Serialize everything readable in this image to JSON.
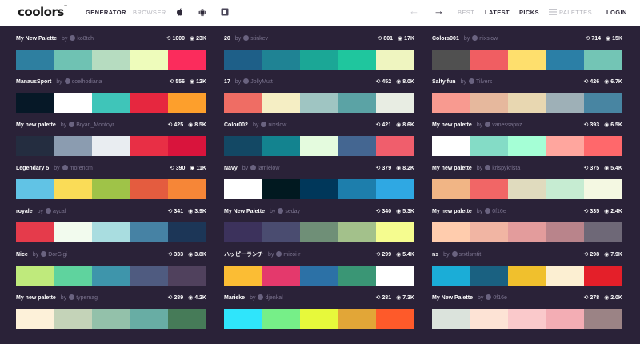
{
  "header": {
    "logo": "coolors",
    "logo_tm": "™",
    "nav": {
      "generator": "GENERATOR",
      "browser": "BROWSER",
      "best": "BEST",
      "latest": "LATEST",
      "picks": "PICKS",
      "palettes": "PALETTES",
      "login": "LOGIN"
    },
    "icons": [
      "apple-icon",
      "android-icon",
      "addon-icon",
      "back-arrow-icon",
      "forward-arrow-icon",
      "menu-icon"
    ]
  },
  "by_label": "by",
  "palettes": [
    {
      "name": "My New Palette",
      "user": "ko8tch",
      "saves": "1000",
      "views": "23K",
      "colors": [
        "#2e7fa0",
        "#6fc2b3",
        "#b6dcc0",
        "#eefcbb",
        "#fb2c5c"
      ]
    },
    {
      "name": "20",
      "user": "stinkev",
      "saves": "801",
      "views": "17K",
      "colors": [
        "#1e5f88",
        "#1f8394",
        "#1ba796",
        "#1fc69e",
        "#eff5c0"
      ]
    },
    {
      "name": "Colors001",
      "user": "nixslow",
      "saves": "714",
      "views": "15K",
      "colors": [
        "#505050",
        "#f05e62",
        "#fedf6d",
        "#2b7fa6",
        "#73c5b5"
      ]
    },
    {
      "name": "ManausSport",
      "user": "coelhodiana",
      "saves": "556",
      "views": "12K",
      "colors": [
        "#061827",
        "#ffffff",
        "#3fc5b9",
        "#e6273f",
        "#fd9f2c"
      ]
    },
    {
      "name": "17",
      "user": "JollyMutt",
      "saves": "452",
      "views": "8.0K",
      "colors": [
        "#ef6d64",
        "#f5eec4",
        "#9fc5c2",
        "#5ba3a5",
        "#e8ede3"
      ]
    },
    {
      "name": "Salty fun",
      "user": "Tilvers",
      "saves": "426",
      "views": "6.7K",
      "colors": [
        "#f89a90",
        "#e6b89d",
        "#e8d7b1",
        "#9eb0b7",
        "#4885a2"
      ]
    },
    {
      "name": "My new palette",
      "user": "Bryan_Montoyr",
      "saves": "425",
      "views": "8.5K",
      "colors": [
        "#242d40",
        "#8b9cb0",
        "#e9edf1",
        "#e82f45",
        "#d9143c"
      ]
    },
    {
      "name": "Color002",
      "user": "nixslow",
      "saves": "421",
      "views": "8.6K",
      "colors": [
        "#134864",
        "#13838f",
        "#e4fbde",
        "#446691",
        "#f05e6c"
      ]
    },
    {
      "name": "My new palette",
      "user": "vanessapnz",
      "saves": "393",
      "views": "6.5K",
      "colors": [
        "#ffffff",
        "#84dcc6",
        "#a5ffd6",
        "#ffa69e",
        "#ff686b"
      ]
    },
    {
      "name": "Legendary 5",
      "user": "morencm",
      "saves": "390",
      "views": "11K",
      "colors": [
        "#61c3e5",
        "#fadc57",
        "#9fc348",
        "#e45c3f",
        "#f68637"
      ]
    },
    {
      "name": "Navy",
      "user": "jamielow",
      "saves": "379",
      "views": "8.2K",
      "colors": [
        "#ffffff",
        "#011920",
        "#00375a",
        "#1d7eac",
        "#2fa8e3"
      ]
    },
    {
      "name": "My new palette",
      "user": "krispykrista",
      "saves": "375",
      "views": "5.4K",
      "colors": [
        "#f1b585",
        "#f16666",
        "#e0dbbe",
        "#c6ecd2",
        "#f4f8e2"
      ]
    },
    {
      "name": "royale",
      "user": "aycal",
      "saves": "341",
      "views": "3.9K",
      "colors": [
        "#e53b4b",
        "#f2fbee",
        "#a9dde0",
        "#4682a4",
        "#1c3657"
      ]
    },
    {
      "name": "My New Palette",
      "user": "seday",
      "saves": "340",
      "views": "5.3K",
      "colors": [
        "#3c325c",
        "#4a4c70",
        "#6f8f77",
        "#a3c18b",
        "#f5fc8f"
      ]
    },
    {
      "name": "My new palette",
      "user": "0f16e",
      "saves": "335",
      "views": "2.4K",
      "colors": [
        "#ffccad",
        "#f1b5a3",
        "#e39c9c",
        "#b9848b",
        "#6e6877"
      ]
    },
    {
      "name": "Nice",
      "user": "DorGigi",
      "saves": "333",
      "views": "3.8K",
      "colors": [
        "#bfea7c",
        "#5fd39e",
        "#3e95ab",
        "#4f5b80",
        "#50415d"
      ]
    },
    {
      "name": "ハッピーランチ",
      "user": "mizoi-r",
      "saves": "299",
      "views": "5.4K",
      "colors": [
        "#fbbd34",
        "#e4396c",
        "#2c71a6",
        "#3a9675",
        "#ffffff"
      ]
    },
    {
      "name": "ns",
      "user": "srxtlsmtit",
      "saves": "298",
      "views": "7.9K",
      "colors": [
        "#1badd7",
        "#1a6181",
        "#f0c02d",
        "#fcefd2",
        "#e41f29"
      ]
    },
    {
      "name": "My new palette",
      "user": "typemag",
      "saves": "289",
      "views": "4.2K",
      "colors": [
        "#fdf1d9",
        "#c4d3b8",
        "#93c1aa",
        "#68ada4",
        "#467b58"
      ]
    },
    {
      "name": "Marieke",
      "user": "djenkal",
      "saves": "281",
      "views": "7.3K",
      "colors": [
        "#2fe5fb",
        "#76ef88",
        "#e7f93b",
        "#e2a637",
        "#fe5a2a"
      ]
    },
    {
      "name": "My New Palette",
      "user": "0f16e",
      "saves": "278",
      "views": "2.0K",
      "colors": [
        "#dbe3dc",
        "#fde3d5",
        "#fac9cb",
        "#f3adb4",
        "#9b8385"
      ]
    }
  ]
}
